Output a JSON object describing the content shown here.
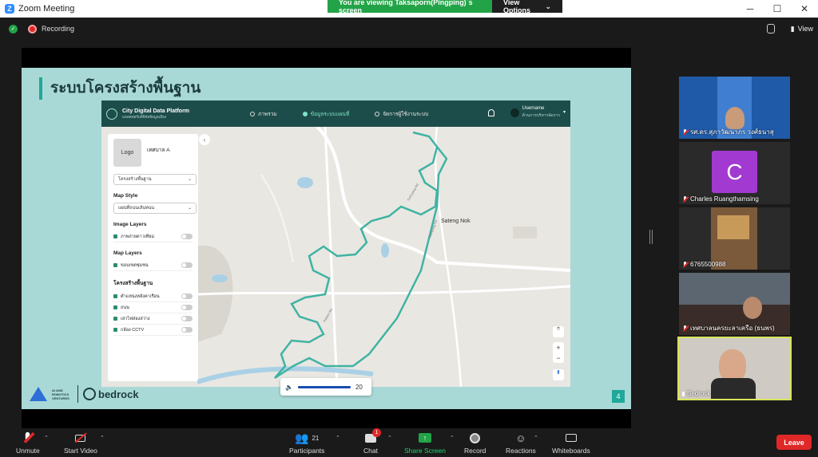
{
  "window": {
    "title": "Zoom Meeting",
    "controls": [
      "─",
      "☐",
      "✕"
    ]
  },
  "banner": {
    "message": "You are viewing Taksaporn(Pingping)`s screen",
    "options_label": "View Options"
  },
  "status": {
    "recording_label": "Recording",
    "view_label": "View"
  },
  "slide": {
    "title": "ระบบโครงสร้างพื้นฐาน",
    "page_number": "4",
    "logo_ai_text": "AI AND ROBOTICS VENTURES",
    "logo_bedrock": "bedrock"
  },
  "app": {
    "title": "City Digital Data Platform",
    "subtitle": "แพลตฟอร์มดิจิทัลข้อมูลเมือง",
    "nav": [
      {
        "label": "ภาพรวม",
        "active": false
      },
      {
        "label": "ข้อมูลระบบแผนที่",
        "active": true
      },
      {
        "label": "จัดการผู้ใช้งานระบบ",
        "active": false
      }
    ],
    "user": {
      "name": "Username",
      "role": "ด้านการบริหารจัดการ"
    },
    "sidebar": {
      "logo_label": "Logo",
      "municipality": "เทศบาล A",
      "layer_select": "โครงสร้างพื้นฐาน",
      "map_style_heading": "Map Style",
      "map_style_value": "แผนที่ถนนเส้นทนน",
      "image_layers_heading": "Image Layers",
      "image_layers": [
        "ภาพถ่ายดาวเทียม"
      ],
      "map_layers_heading": "Map Layers",
      "map_layers": [
        "ขอบเขตชุมชน"
      ],
      "infra_heading": "โครงสร้างพื้นฐาน",
      "infra_layers": [
        "ตำแหน่งหลังคาเรือน",
        "ถนน",
        "เสาไฟส่องสว่าง",
        "กล้อง CCTV"
      ]
    },
    "map": {
      "place_label": "Sateng Nok",
      "zoom_in": "+",
      "zoom_out": "−",
      "road_labels": [
        "Sukhyang Rd",
        "Sukhyang Rd",
        "Pattani Rd"
      ]
    }
  },
  "volume": {
    "value": "20"
  },
  "participants": [
    {
      "name": "รศ.ดร.สุภาวัฒนาภร วงศ์ธนาสุ"
    },
    {
      "name": "Charles Ruangthamsing",
      "initial": "C"
    },
    {
      "name": "6765500988"
    },
    {
      "name": "เทศบาลนครยะลาเครือ (ธนพร)"
    },
    {
      "name": "Bedrock"
    }
  ],
  "toolbar": {
    "unmute": "Unmute",
    "start_video": "Start Video",
    "participants": "Participants",
    "participants_count": "21",
    "chat": "Chat",
    "chat_badge": "1",
    "share_screen": "Share Screen",
    "record": "Record",
    "reactions": "Reactions",
    "whiteboards": "Whiteboards",
    "leave": "Leave"
  },
  "colors": {
    "zoom_blue": "#2d8cff",
    "share_green": "#23a347",
    "leave_red": "#e02828",
    "app_header": "#1d4d4a",
    "slide_bg": "#a9d9d6",
    "river": "#3fb3a3"
  }
}
